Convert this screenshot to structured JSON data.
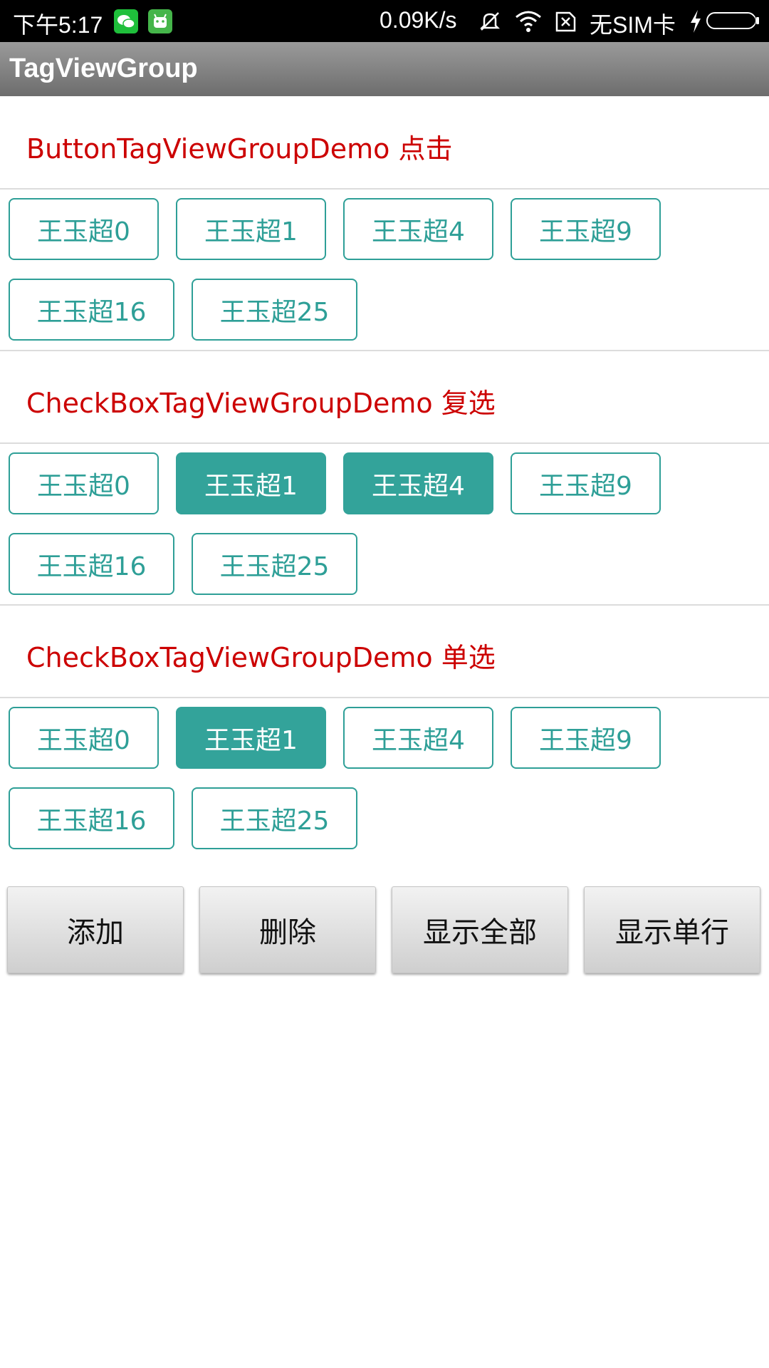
{
  "status_bar": {
    "time": "下午5:17",
    "net_speed": "0.09K/s",
    "carrier": "无SIM卡",
    "icons": [
      "wechat-icon",
      "android-icon",
      "mute-icon",
      "wifi-icon",
      "no-sim-icon",
      "charging-icon",
      "battery-icon"
    ]
  },
  "app": {
    "title": "TagViewGroup"
  },
  "sections": [
    {
      "title": "ButtonTagViewGroupDemo 点击",
      "tags": [
        {
          "label": "王玉超0",
          "selected": false
        },
        {
          "label": "王玉超1",
          "selected": false
        },
        {
          "label": "王玉超4",
          "selected": false
        },
        {
          "label": "王玉超9",
          "selected": false
        },
        {
          "label": "王玉超16",
          "selected": false
        },
        {
          "label": "王玉超25",
          "selected": false
        }
      ]
    },
    {
      "title": "CheckBoxTagViewGroupDemo 复选",
      "tags": [
        {
          "label": "王玉超0",
          "selected": false
        },
        {
          "label": "王玉超1",
          "selected": true
        },
        {
          "label": "王玉超4",
          "selected": true
        },
        {
          "label": "王玉超9",
          "selected": false
        },
        {
          "label": "王玉超16",
          "selected": false
        },
        {
          "label": "王玉超25",
          "selected": false
        }
      ]
    },
    {
      "title": "CheckBoxTagViewGroupDemo 单选",
      "tags": [
        {
          "label": "王玉超0",
          "selected": false
        },
        {
          "label": "王玉超1",
          "selected": true
        },
        {
          "label": "王玉超4",
          "selected": false
        },
        {
          "label": "王玉超9",
          "selected": false
        },
        {
          "label": "王玉超16",
          "selected": false
        },
        {
          "label": "王玉超25",
          "selected": false
        }
      ]
    }
  ],
  "actions": {
    "add": "添加",
    "delete": "删除",
    "show_all": "显示全部",
    "show_single_line": "显示单行"
  },
  "colors": {
    "accent": "#2e9f97",
    "section_title": "#cc0000",
    "title_bar": "#808080"
  }
}
